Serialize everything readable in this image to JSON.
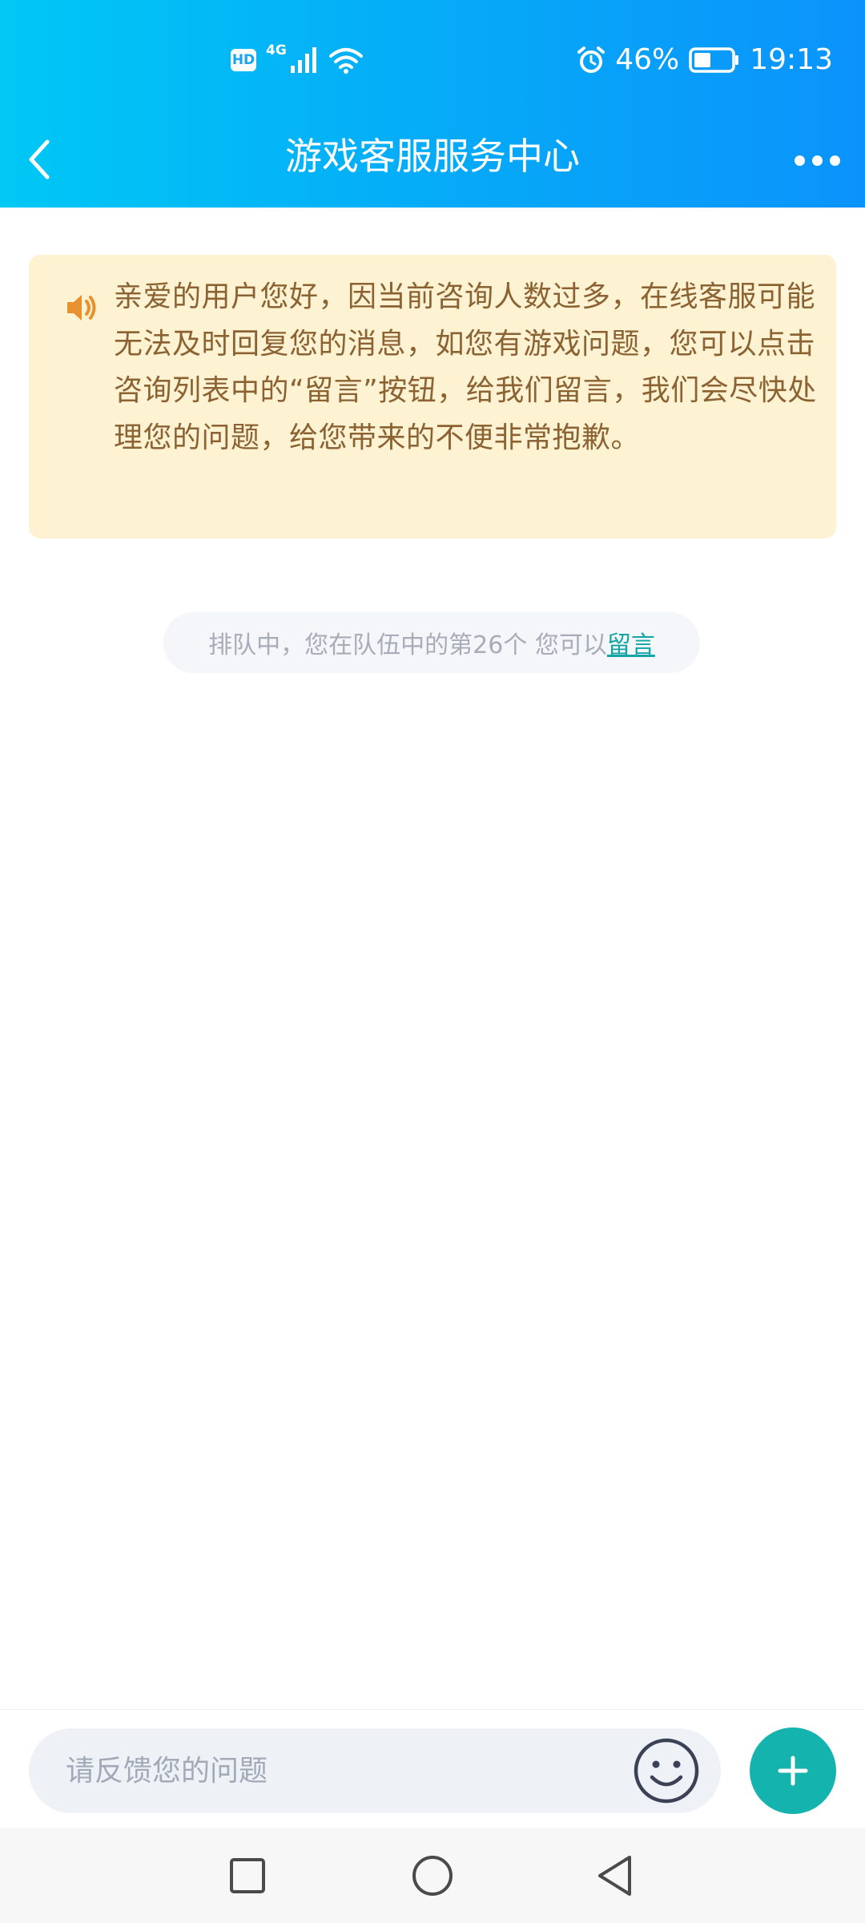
{
  "status_bar": {
    "hd": "HD",
    "network": "4G",
    "battery_percent": "46%",
    "battery_level": 0.46,
    "time": "19:13",
    "icons": [
      "hd-icon",
      "signal-icon",
      "wifi-icon",
      "alarm-icon",
      "battery-icon"
    ]
  },
  "nav": {
    "title": "游戏客服服务中心",
    "back_icon": "chevron-left-icon",
    "more_icon": "more-dots-icon"
  },
  "notice": {
    "icon": "speaker-icon",
    "text": "亲爱的用户您好，因当前咨询人数过多，在线客服可能无法及时回复您的消息，如您有游戏问题，您可以点击咨询列表中的“留言”按钮，给我们留言，我们会尽快处理您的问题，给您带来的不便非常抱歉。"
  },
  "queue": {
    "text": "排队中，您在队伍中的第26个 您可以",
    "link": "留言"
  },
  "composer": {
    "placeholder": "请反馈您的问题",
    "emoji_icon": "smiley-icon",
    "plus_icon": "plus-icon"
  },
  "system_nav": {
    "icons": [
      "recent-apps-icon",
      "home-icon",
      "back-triangle-icon"
    ]
  },
  "colors": {
    "header_start": "#00c8f5",
    "header_end": "#0b93fb",
    "notice_bg": "#fdf3d3",
    "notice_text": "#8c6232",
    "link": "#13a5a5",
    "plus_button": "#15b3ad"
  }
}
